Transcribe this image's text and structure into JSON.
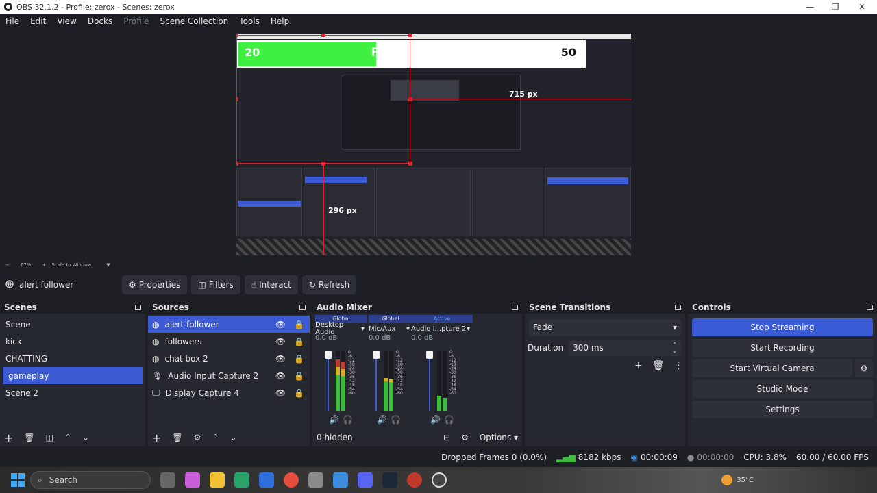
{
  "window": {
    "title": "OBS 32.1.2 - Profile: zerox - Scenes: zerox",
    "minimize": "—",
    "maximize": "❐",
    "close": "✕"
  },
  "menu": [
    "File",
    "Edit",
    "View",
    "Docks",
    "Profile",
    "Scene Collection",
    "Tools",
    "Help"
  ],
  "preview": {
    "followers_left": "20",
    "followers_title": "FOLLOWERS",
    "followers_right": "50",
    "dim_width": "715 px",
    "dim_height": "296 px"
  },
  "zoom": {
    "minus": "−",
    "level": "67%",
    "plus": "+",
    "mode": "Scale to Window"
  },
  "source_toolbar": {
    "selected_source": "alert follower",
    "properties": "Properties",
    "filters": "Filters",
    "interact": "Interact",
    "refresh": "Refresh"
  },
  "scenes": {
    "title": "Scenes",
    "items": [
      "Scene",
      "kick",
      "CHATTING",
      "gameplay",
      "Scene 2"
    ],
    "selected": 3
  },
  "sources": {
    "title": "Sources",
    "items": [
      "alert follower",
      "followers",
      "chat box 2",
      "Audio Input Capture 2",
      "Display Capture 4"
    ],
    "selected": 0
  },
  "audio_mixer": {
    "title": "Audio Mixer",
    "channels": [
      {
        "tag": "Global",
        "name": "Desktop Audio",
        "db": "0.0 dB"
      },
      {
        "tag": "Global",
        "name": "Mic/Aux",
        "db": "0.0 dB"
      },
      {
        "tag": "Active",
        "name": "Audio I...pture 2",
        "db": "0.0 dB"
      }
    ],
    "scale": [
      "0",
      "-6",
      "-12",
      "-18",
      "-24",
      "-30",
      "-36",
      "-42",
      "-48",
      "-54",
      "-60"
    ],
    "hidden": "0 hidden",
    "options": "Options"
  },
  "transitions": {
    "title": "Scene Transitions",
    "selected": "Fade",
    "duration_label": "Duration",
    "duration_value": "300 ms"
  },
  "controls": {
    "title": "Controls",
    "stop_streaming": "Stop Streaming",
    "start_recording": "Start Recording",
    "start_virtual_camera": "Start Virtual Camera",
    "studio_mode": "Studio Mode",
    "settings": "Settings"
  },
  "status": {
    "dropped_frames": "Dropped Frames 0 (0.0%)",
    "bitrate": "8182 kbps",
    "stream_time": "00:00:09",
    "record_time": "00:00:00",
    "cpu": "CPU: 3.8%",
    "fps": "60.00 / 60.00 FPS"
  },
  "taskbar": {
    "search": "Search",
    "weather": "35°C"
  },
  "colors": {
    "accent": "#3a5ad6",
    "red_outline": "#e0202a",
    "follower_green": "#3ff040",
    "background": "#1e1f25"
  }
}
